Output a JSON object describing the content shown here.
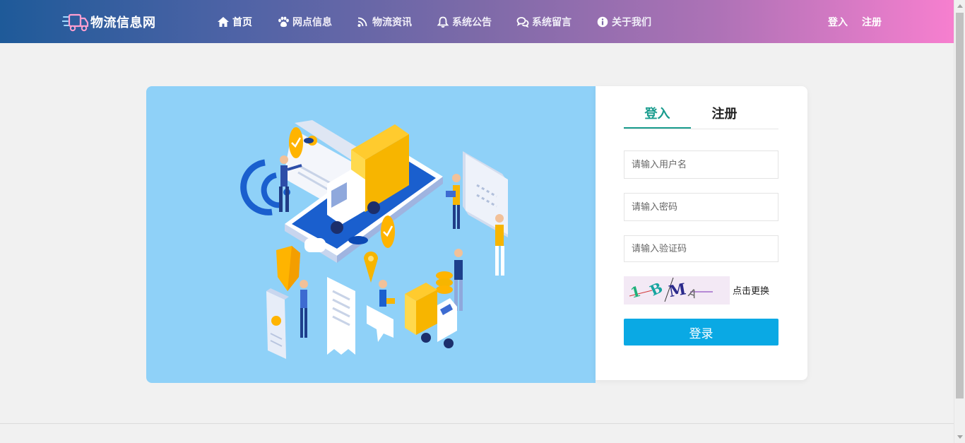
{
  "header": {
    "brand": "物流信息网",
    "nav": [
      {
        "label": "首页",
        "icon": "home-icon"
      },
      {
        "label": "网点信息",
        "icon": "paw-icon"
      },
      {
        "label": "物流资讯",
        "icon": "rss-icon"
      },
      {
        "label": "系统公告",
        "icon": "bell-icon"
      },
      {
        "label": "系统留言",
        "icon": "comments-icon"
      },
      {
        "label": "关于我们",
        "icon": "info-icon"
      }
    ],
    "login_link": "登入",
    "register_link": "注册"
  },
  "login": {
    "tab_login": "登入",
    "tab_register": "注册",
    "username_placeholder": "请输入用户名",
    "password_placeholder": "请输入密码",
    "captcha_placeholder": "请输入验证码",
    "captcha_refresh": "点击更换",
    "submit": "登录"
  },
  "colors": {
    "accent_tab": "#1a9c8e",
    "submit_button": "#0aa9e4",
    "illustration_bg": "#8fd1f8",
    "header_gradient_start": "#1e5a99",
    "header_gradient_end": "#f77fcf"
  }
}
